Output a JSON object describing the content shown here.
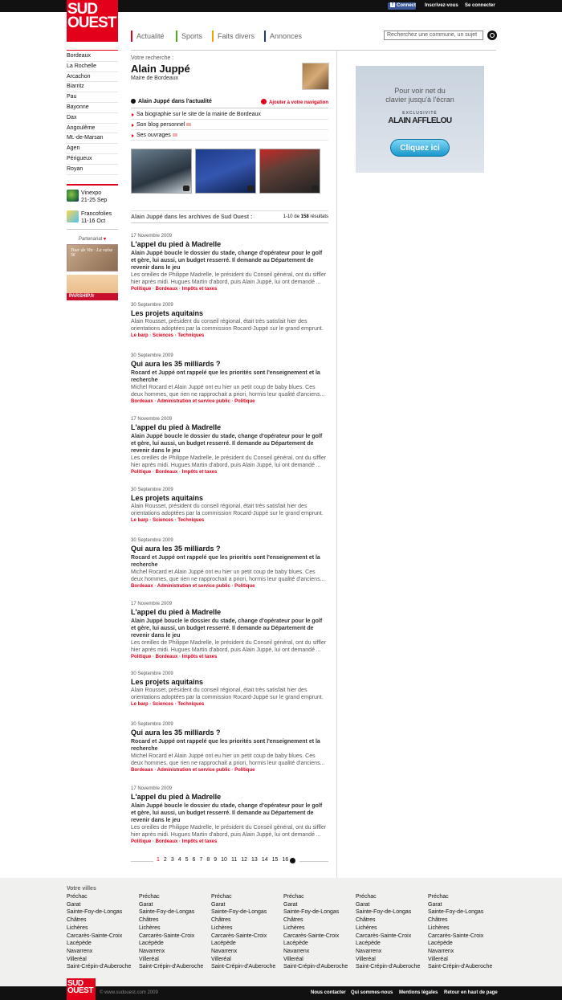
{
  "topbar": {
    "connect": "Connect",
    "register": "Inscrivez-vous",
    "login": "Se connecter"
  },
  "logo": {
    "line1": "SUD",
    "line2": "OUEST"
  },
  "nav": [
    {
      "label": "Actualité",
      "color": "#e2001a"
    },
    {
      "label": "Sports",
      "color": "#4caf1a"
    },
    {
      "label": "Faits divers",
      "color": "#f0a000"
    },
    {
      "label": "Annonces",
      "color": "#1a3a7a"
    }
  ],
  "search": {
    "placeholder": "Recherchez une commune, un sujet"
  },
  "sidebar": {
    "cities": [
      "Bordeaux",
      "La Rochelle",
      "Arcachon",
      "Biarritz",
      "Pau",
      "Bayonne",
      "Dax",
      "Angoulême",
      "Mt.-de-Marsan",
      "Agen",
      "Périgueux",
      "Royan"
    ],
    "events": [
      {
        "name": "Vinexpo",
        "dates": "21-25 Sep"
      },
      {
        "name": "Francofolies",
        "dates": "11-16 Oct"
      }
    ],
    "partner_label": "Partenariat",
    "ads": [
      {
        "text": "Tour de Vin · La valse 5€"
      },
      {
        "text": "PARSHIP.fr"
      }
    ]
  },
  "profile": {
    "search_label": "Votre recherche :",
    "name": "Alain Juppé",
    "role": "Maire de Bordeaux",
    "news_title": "Alain Juppé dans l'actualité",
    "add_nav": "Ajouter à votre navigation",
    "links": [
      "Sa biographie sur le site de la mairie de Bordeaux",
      "Son blog personnel",
      "Ses ouvrages"
    ]
  },
  "archive": {
    "label": "Alain Juppé dans les archives de Sud Ouest :",
    "count_prefix": "1-10 de ",
    "count": "158",
    "count_suffix": " résultats"
  },
  "articles": [
    {
      "date": "17 Novembre 2009",
      "title": "L'appel du pied à Madrelle",
      "lead": "Alain Juppé boucle le dossier du stade, change d'opérateur pour le golf et gère, lui aussi, un budget resserré. Il demande au Département de revenir dans le jeu",
      "body": "Les oreilles de Philippe Madrelle, le président du Conseil général, ont du siffler hier après midi. Hugues Martin d'abord, puis Alain Juppé, lui ont demandé ...",
      "tags": "Politique · Bordeaux · Impôts et taxes"
    },
    {
      "date": "30 Septembre 2009",
      "title": "Les projets aquitains",
      "lead": "",
      "body": "Alain Rousset, président du conseil régional, était très satisfait hier des orientations adoptées par la commission Rocard-Juppé sur le grand emprunt.",
      "tags": "Le barp · Sciences · Techniques"
    },
    {
      "date": "30 Septembre 2009",
      "title": "Qui aura les 35 milliards ?",
      "lead": "Rocard et Juppé ont rappelé que les priorités sont l'enseignement et la recherche",
      "body": "Michel Rocard et Alain Juppé ont eu hier un petit coup de baby blues. Ces deux hommes, que rien ne rapprochait a priori, hormis leur qualité d'anciens...",
      "tags": "Bordeaux · Administration et service public · Politique"
    },
    {
      "date": "17 Novembre 2009",
      "title": "L'appel du pied à Madrelle",
      "lead": "Alain Juppé boucle le dossier du stade, change d'opérateur pour le golf et gère, lui aussi, un budget resserré. Il demande au Département de revenir dans le jeu",
      "body": "Les oreilles de Philippe Madrelle, le président du Conseil général, ont du siffler hier après midi. Hugues Martin d'abord, puis Alain Juppé, lui ont demandé ...",
      "tags": "Politique · Bordeaux · Impôts et taxes"
    },
    {
      "date": "30 Septembre 2009",
      "title": "Les projets aquitains",
      "lead": "",
      "body": "Alain Rousset, président du conseil régional, était très satisfait hier des orientations adoptées par la commission Rocard-Juppé sur le grand emprunt.",
      "tags": "Le barp · Sciences · Techniques"
    },
    {
      "date": "30 Septembre 2009",
      "title": "Qui aura les 35 milliards ?",
      "lead": "Rocard et Juppé ont rappelé que les priorités sont l'enseignement et la recherche",
      "body": "Michel Rocard et Alain Juppé ont eu hier un petit coup de baby blues. Ces deux hommes, que rien ne rapprochait a priori, hormis leur qualité d'anciens...",
      "tags": "Bordeaux · Administration et service public · Politique"
    },
    {
      "date": "17 Novembre 2009",
      "title": "L'appel du pied à Madrelle",
      "lead": "Alain Juppé boucle le dossier du stade, change d'opérateur pour le golf et gère, lui aussi, un budget resserré. Il demande au Département de revenir dans le jeu",
      "body": "Les oreilles de Philippe Madrelle, le président du Conseil général, ont du siffler hier après midi. Hugues Martin d'abord, puis Alain Juppé, lui ont demandé ...",
      "tags": "Politique · Bordeaux · Impôts et taxes"
    },
    {
      "date": "30 Septembre 2009",
      "title": "Les projets aquitains",
      "lead": "",
      "body": "Alain Rousset, président du conseil régional, était très satisfait hier des orientations adoptées par la commission Rocard-Juppé sur le grand emprunt.",
      "tags": "Le barp · Sciences · Techniques"
    },
    {
      "date": "30 Septembre 2009",
      "title": "Qui aura les 35 milliards ?",
      "lead": "Rocard et Juppé ont rappelé que les priorités sont l'enseignement et la recherche",
      "body": "Michel Rocard et Alain Juppé ont eu hier un petit coup de baby blues. Ces deux hommes, que rien ne rapprochait a priori, hormis leur qualité d'anciens...",
      "tags": "Bordeaux · Administration et service public · Politique"
    },
    {
      "date": "17 Novembre 2009",
      "title": "L'appel du pied à Madrelle",
      "lead": "Alain Juppé boucle le dossier du stade, change d'opérateur pour le golf et gère, lui aussi, un budget resserré. Il demande au Département de revenir dans le jeu",
      "body": "Les oreilles de Philippe Madrelle, le président du Conseil général, ont du siffler hier après midi. Hugues Martin d'abord, puis Alain Juppé, lui ont demandé ...",
      "tags": "Politique · Bordeaux · Impôts et taxes"
    }
  ],
  "pagination": {
    "current": "1",
    "pages": [
      "2",
      "3",
      "4",
      "5",
      "6",
      "7",
      "8",
      "9",
      "10",
      "11",
      "12",
      "13",
      "14",
      "15",
      "16"
    ]
  },
  "ad": {
    "line1": "Pour voir net du",
    "line2": "clavier jusqu'à l'écran",
    "exclusive": "EXCLUSIVITÉ",
    "brand": "ALAIN AFFLELOU",
    "button": "Cliquez ici"
  },
  "footer": {
    "title": "Votre villes",
    "towns": [
      "Préchac",
      "Garat",
      "Sainte-Foy-de-Longas",
      "Châtres",
      "Lichères",
      "Carcarès-Sainte-Croix",
      "Lacépède",
      "Navarrenx",
      "Villeréal",
      "Saint-Crépin-d'Auberoche"
    ],
    "copyright": "© www.sudouest.com 2009",
    "links": [
      "Nous contacter",
      "Qui sommes-nous",
      "Mentions légales",
      "Retour en haut de page"
    ]
  }
}
